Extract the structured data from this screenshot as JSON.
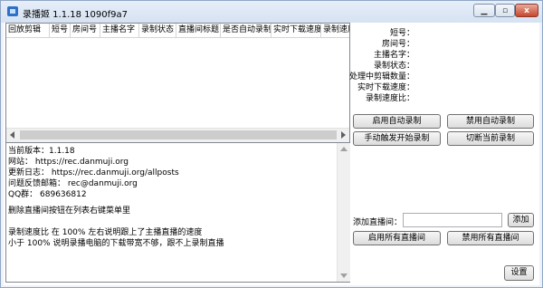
{
  "window": {
    "title": "录播姬 1.1.18 1090f9a7",
    "min_glyph": "▁",
    "max_glyph": "▫",
    "close_glyph": "x"
  },
  "grid": {
    "columns": [
      "回放剪辑",
      "短号",
      "房间号",
      "主播名字",
      "录制状态",
      "直播间标题",
      "是否自动录制",
      "实时下载速度",
      "录制速度比"
    ]
  },
  "log": {
    "lines": [
      "当前版本：1.1.18",
      "网站： https://rec.danmuji.org",
      "更新日志： https://rec.danmuji.org/allposts",
      "问题反馈邮箱： rec@danmuji.org",
      "QQ群： 689636812",
      "",
      "删除直播间按钮在列表右键菜单里",
      "",
      "录制速度比 在 100% 左右说明跟上了主播直播的速度",
      "小于 100% 说明录播电脑的下载带宽不够，跟不上录制直播"
    ]
  },
  "info": {
    "labels": [
      "短号：",
      "房间号：",
      "主播名字：",
      "录制状态：",
      "处理中剪辑数量：",
      "实时下载速度：",
      "录制速度比："
    ]
  },
  "buttons": {
    "enable_auto": "启用自动录制",
    "disable_auto": "禁用自动录制",
    "manual_start": "手动触发开始录制",
    "cut_record": "切断当前录制",
    "add": "添加",
    "enable_all": "启用所有直播间",
    "disable_all": "禁用所有直播间",
    "settings": "设置"
  },
  "add_room": {
    "label": "添加直播间：",
    "value": ""
  }
}
